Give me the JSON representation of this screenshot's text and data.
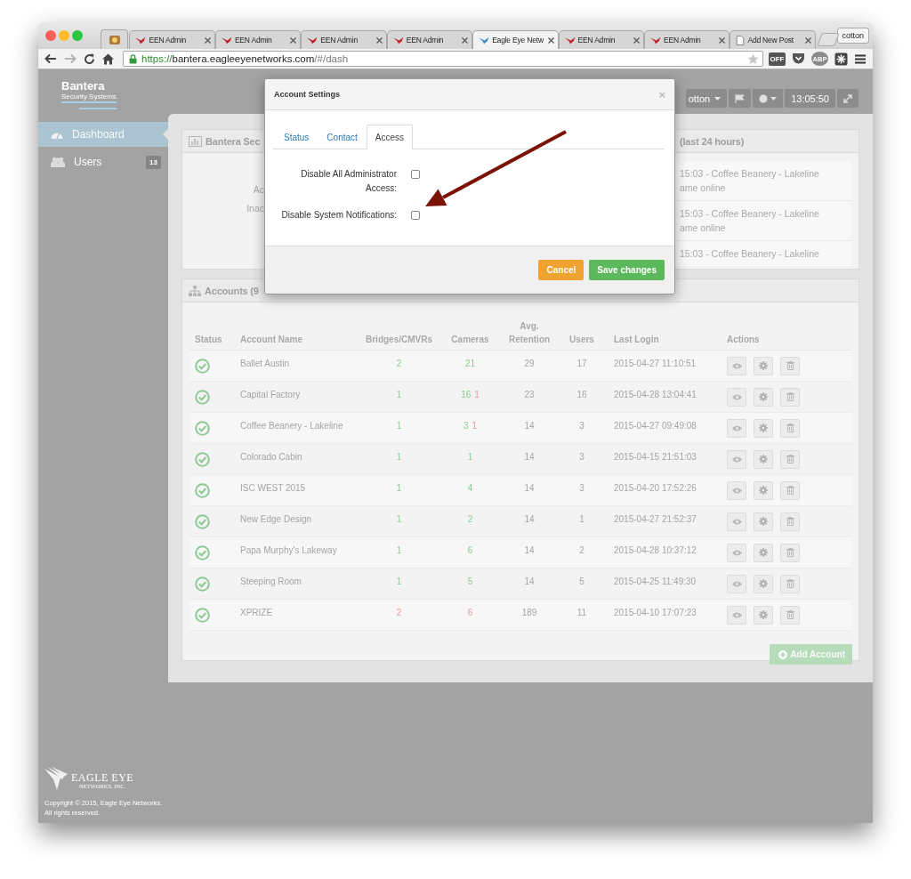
{
  "browser": {
    "tabs": [
      {
        "label": "EEN Admin",
        "kind": "een",
        "selected": false
      },
      {
        "label": "EEN Admin",
        "kind": "een",
        "selected": false
      },
      {
        "label": "EEN Admin",
        "kind": "een",
        "selected": false
      },
      {
        "label": "EEN Admin",
        "kind": "een",
        "selected": false
      },
      {
        "label": "Eagle Eye Netw",
        "kind": "eagle",
        "selected": true
      },
      {
        "label": "EEN Admin",
        "kind": "een",
        "selected": false
      },
      {
        "label": "EEN Admin",
        "kind": "een",
        "selected": false
      },
      {
        "label": "Add New Post",
        "kind": "doc",
        "selected": false
      }
    ],
    "profile": "cotton",
    "forward_disabled": true,
    "url": {
      "scheme": "https://",
      "host": "bantera.eagleeyenetworks.com",
      "path": "/#/dash"
    },
    "extensions": [
      {
        "kind": "off",
        "label": "OFF"
      },
      {
        "kind": "pocket"
      },
      {
        "kind": "abp",
        "label": "ABP"
      },
      {
        "kind": "puzzle"
      }
    ]
  },
  "header": {
    "brand": "Bantera",
    "tagline": "Security Systems",
    "user": "otton",
    "clock": "13:05:50"
  },
  "sidebar": {
    "items": [
      {
        "label": "Dashboard",
        "kind": "dashboard",
        "selected": true
      },
      {
        "label": "Users",
        "kind": "users",
        "selected": false,
        "badge": "13"
      }
    ],
    "footer": {
      "company": "EAGLE EYE",
      "company_sub": "NETWORKS, INC.",
      "copyright": [
        "Copyright © 2015, Eagle Eye Networks.",
        "All rights reserved."
      ]
    }
  },
  "status_panel": {
    "title": "Bantera Sec",
    "labels": [
      "Ac",
      "Inac"
    ]
  },
  "notifications_panel": {
    "title": "(last 24 hours)",
    "items": [
      {
        "lines": [
          "15:03 - Coffee Beanery - Lakeline",
          "ame online"
        ]
      },
      {
        "lines": [
          "15:03 - Coffee Beanery - Lakeline",
          "ame online"
        ]
      },
      {
        "lines": [
          "15:03 - Coffee Beanery - Lakeline"
        ]
      }
    ]
  },
  "accounts": {
    "title": "Accounts (9",
    "columns": [
      "Status",
      "Account Name",
      "Bridges/CMVRs",
      "Cameras",
      "Avg. Retention",
      "Users",
      "Last Login",
      "Actions"
    ],
    "rows": [
      {
        "name": "Ballet Austin",
        "bridges": {
          "value": "2",
          "alert": false
        },
        "cameras": [
          {
            "value": "21",
            "alert": false
          }
        ],
        "retention": "29",
        "users": "17",
        "last_login": "2015-04-27 11:10:51"
      },
      {
        "name": "Capital Factory",
        "bridges": {
          "value": "1",
          "alert": false
        },
        "cameras": [
          {
            "value": "16",
            "alert": false
          },
          {
            "value": "1",
            "alert": true
          }
        ],
        "retention": "23",
        "users": "16",
        "last_login": "2015-04-28 13:04:41"
      },
      {
        "name": "Coffee Beanery - Lakeline",
        "bridges": {
          "value": "1",
          "alert": false
        },
        "cameras": [
          {
            "value": "3",
            "alert": false
          },
          {
            "value": "1",
            "alert": true
          }
        ],
        "retention": "14",
        "users": "3",
        "last_login": "2015-04-27 09:49:08"
      },
      {
        "name": "Colorado Cabin",
        "bridges": {
          "value": "1",
          "alert": false
        },
        "cameras": [
          {
            "value": "1",
            "alert": false
          }
        ],
        "retention": "14",
        "users": "3",
        "last_login": "2015-04-15 21:51:03"
      },
      {
        "name": "ISC WEST 2015",
        "bridges": {
          "value": "1",
          "alert": false
        },
        "cameras": [
          {
            "value": "4",
            "alert": false
          }
        ],
        "retention": "14",
        "users": "3",
        "last_login": "2015-04-20 17:52:26"
      },
      {
        "name": "New Edge Design",
        "bridges": {
          "value": "1",
          "alert": false
        },
        "cameras": [
          {
            "value": "2",
            "alert": false
          }
        ],
        "retention": "14",
        "users": "1",
        "last_login": "2015-04-27 21:52:37"
      },
      {
        "name": "Papa Murphy's Lakeway",
        "bridges": {
          "value": "1",
          "alert": false
        },
        "cameras": [
          {
            "value": "6",
            "alert": false
          }
        ],
        "retention": "14",
        "users": "2",
        "last_login": "2015-04-28 10:37:12"
      },
      {
        "name": "Steeping Room",
        "bridges": {
          "value": "1",
          "alert": false
        },
        "cameras": [
          {
            "value": "5",
            "alert": false
          }
        ],
        "retention": "14",
        "users": "5",
        "last_login": "2015-04-25 11:49:30"
      },
      {
        "name": "XPRIZE",
        "bridges": {
          "value": "2",
          "alert": true
        },
        "cameras": [
          {
            "value": "6",
            "alert": true
          }
        ],
        "retention": "189",
        "users": "11",
        "last_login": "2015-04-10 17:07:23"
      }
    ],
    "add_button": "Add Account"
  },
  "modal": {
    "title": "Account Settings",
    "close": "×",
    "tabs": [
      {
        "label": "Status",
        "selected": false
      },
      {
        "label": "Contact",
        "selected": false
      },
      {
        "label": "Access",
        "selected": true
      }
    ],
    "options": [
      {
        "label": "Disable All Administrator Access:",
        "checked": false
      },
      {
        "label": "Disable System Notifications:",
        "checked": false
      }
    ],
    "buttons": [
      {
        "kind": "cancel",
        "label": "Cancel"
      },
      {
        "kind": "save",
        "label": "Save changes"
      }
    ]
  }
}
